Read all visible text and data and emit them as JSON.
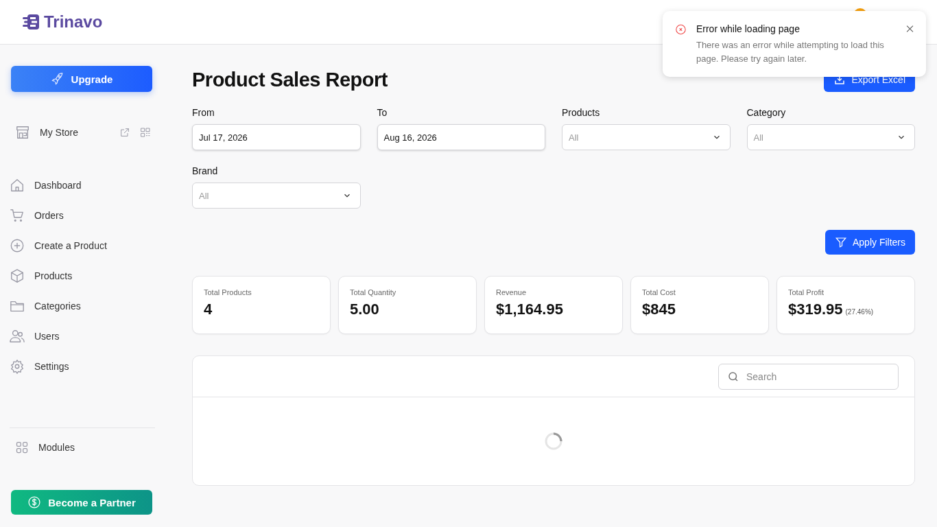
{
  "brand": {
    "name": "Trinavo"
  },
  "sidebar": {
    "upgrade": "Upgrade",
    "store": {
      "name": "My Store"
    },
    "items": [
      {
        "label": "Dashboard"
      },
      {
        "label": "Orders"
      },
      {
        "label": "Create a Product"
      },
      {
        "label": "Products"
      },
      {
        "label": "Categories"
      },
      {
        "label": "Users"
      },
      {
        "label": "Settings"
      }
    ],
    "modules": "Modules",
    "partner": "Become a Partner"
  },
  "page": {
    "title": "Product Sales Report",
    "export": "Export Excel"
  },
  "filters": [
    {
      "label": "From",
      "kind": "date",
      "value": "Jul 17, 2026"
    },
    {
      "label": "To",
      "kind": "date",
      "value": "Aug 16, 2026"
    },
    {
      "label": "Products",
      "kind": "select",
      "placeholder": "All"
    },
    {
      "label": "Category",
      "kind": "select",
      "placeholder": "All"
    },
    {
      "label": "Brand",
      "kind": "select",
      "placeholder": "All"
    }
  ],
  "apply": "Apply Filters",
  "stats": [
    {
      "label": "Total Products",
      "value": "4"
    },
    {
      "label": "Total Quantity",
      "value": "5.00"
    },
    {
      "label": "Revenue",
      "value": "$1,164.95"
    },
    {
      "label": "Total Cost",
      "value": "$845"
    },
    {
      "label": "Total Profit",
      "value": "$319.95",
      "note": "(27.46%)"
    }
  ],
  "table": {
    "search": {
      "placeholder": "Search"
    },
    "loading": true
  },
  "toast": {
    "title": "Error while loading page",
    "message": "There was an error while attempting to load this page. Please try again later."
  }
}
